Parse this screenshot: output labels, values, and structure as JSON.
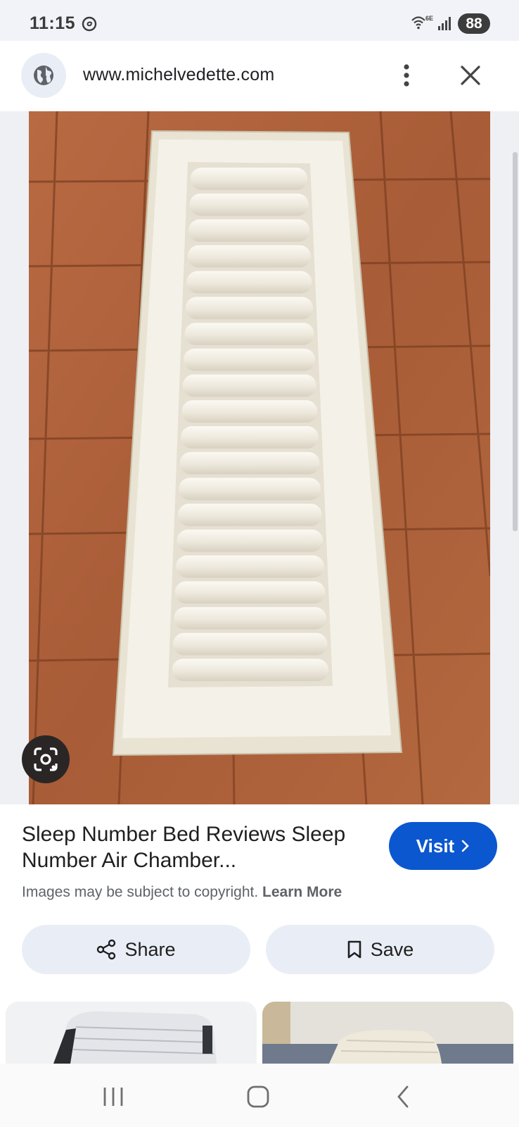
{
  "status_bar": {
    "time": "11:15",
    "network_label": "6E",
    "battery": "88",
    "icons": [
      "threads-icon",
      "wifi-icon",
      "signal-icon"
    ]
  },
  "browser": {
    "url": "www.michelvedette.com",
    "icons": [
      "globe-icon",
      "more-vert-icon",
      "close-icon"
    ]
  },
  "result": {
    "title": "Sleep Number Bed Reviews Sleep Number Air Chamber...",
    "visit_label": "Visit",
    "copyright_text": "Images may be subject to copyright.",
    "learn_more_label": "Learn More"
  },
  "actions": {
    "share_label": "Share",
    "save_label": "Save"
  },
  "colors": {
    "accent": "#0b57d0",
    "pill_background": "#e9eef6",
    "status_bar_background": "#f2f3f8",
    "tile_floor": "#b0653e",
    "mattress": "#f1ede2"
  },
  "nav": {
    "icons": [
      "recents-icon",
      "home-icon",
      "back-icon"
    ]
  }
}
